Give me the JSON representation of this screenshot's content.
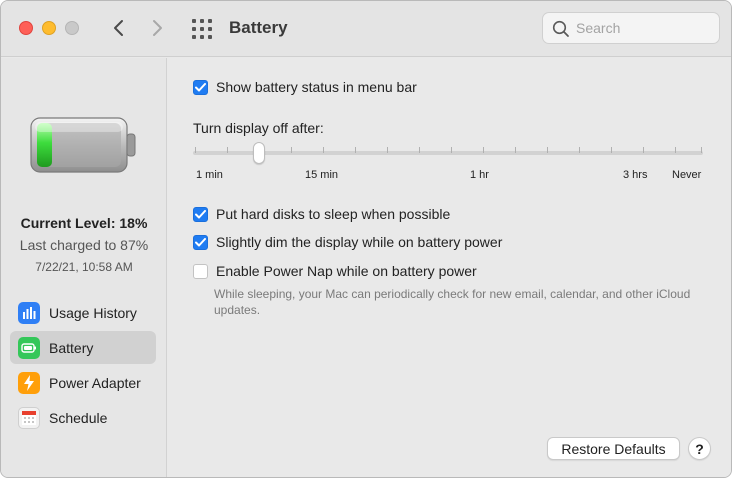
{
  "window": {
    "title": "Battery",
    "search_placeholder": "Search"
  },
  "sidebar": {
    "current_level": "Current Level: 18%",
    "last_charged": "Last charged to 87%",
    "charge_date": "7/22/21, 10:58 AM",
    "battery_level_fraction": 0.18,
    "items": [
      {
        "label": "Usage History",
        "icon": "bar-chart-icon",
        "color": "#2f7ff5",
        "active": false
      },
      {
        "label": "Battery",
        "icon": "battery-icon",
        "color": "#34c759",
        "active": true
      },
      {
        "label": "Power Adapter",
        "icon": "lightning-icon",
        "color": "#ff9f0a",
        "active": false
      },
      {
        "label": "Schedule",
        "icon": "calendar-icon",
        "color": "#f2f2f2",
        "active": false
      }
    ]
  },
  "main": {
    "show_status": {
      "label": "Show battery status in menu bar",
      "checked": true
    },
    "display_off": {
      "label": "Turn display off after:",
      "tick_labels": [
        "1 min",
        "15 min",
        "1 hr",
        "3 hrs",
        "Never"
      ],
      "selected_position": "2 min"
    },
    "options": [
      {
        "label": "Put hard disks to sleep when possible",
        "checked": true
      },
      {
        "label": "Slightly dim the display while on battery power",
        "checked": true
      },
      {
        "label": "Enable Power Nap while on battery power",
        "checked": false
      }
    ],
    "power_nap_help": "While sleeping, your Mac can periodically check for new email, calendar, and other iCloud updates.",
    "restore_defaults": "Restore Defaults",
    "help": "?"
  },
  "colors": {
    "accent": "#1f7cf2",
    "battery_green": "#3ddc3d"
  }
}
